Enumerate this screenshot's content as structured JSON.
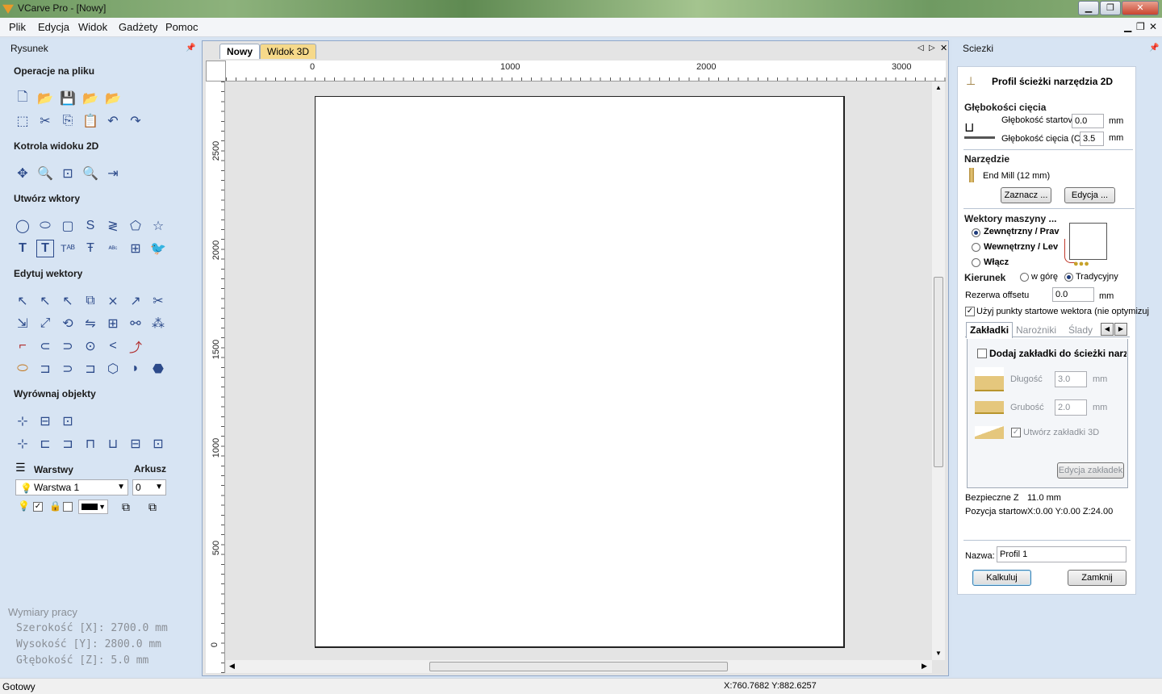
{
  "window": {
    "title": "VCarve Pro - [Nowy]"
  },
  "menu": [
    "Plik",
    "Edycja",
    "Widok",
    "Gadżety",
    "Pomoc"
  ],
  "left_panel": {
    "title": "Rysunek",
    "sections": [
      "Operacje na pliku",
      "Kotrola widoku 2D",
      "Utwórz wktory",
      "Edytuj wektory",
      "Wyrównaj objekty"
    ],
    "layers_label": "Warstwy",
    "sheet_label": "Arkusz",
    "layer_select": "Warstwa 1",
    "sheet_select": "0",
    "dimensions": {
      "title": "Wymiary pracy",
      "width": "Szerokość [X]: 2700.0 mm",
      "height": "Wysokość  [Y]: 2800.0 mm",
      "depth": "Głębokość [Z]: 5.0 mm"
    }
  },
  "tabs": [
    "Nowy",
    "Widok 3D"
  ],
  "ruler_top": [
    "0",
    "1000",
    "2000",
    "3000"
  ],
  "ruler_left": [
    "2500",
    "2000",
    "1500",
    "1000",
    "500",
    "0"
  ],
  "right_panel": {
    "title": "Sciezki",
    "heading": "Profil ścieżki narzędzia 2D",
    "cut_depths": {
      "label": "Głębokości cięcia",
      "start_label": "Głębokość startov",
      "start_value": "0.0",
      "cut_label": "Głębokość cięcia (C)",
      "cut_value": "3.5",
      "unit": "mm"
    },
    "tool": {
      "label": "Narzędzie",
      "name": "End Mill (12 mm)",
      "select_btn": "Zaznacz ...",
      "edit_btn": "Edycja ..."
    },
    "machine_vectors": {
      "label": "Wektory maszyny ...",
      "outside": "Zewnętrzny / Prav",
      "inside": "Wewnętrzny / Lev",
      "on": "Włącz"
    },
    "direction": {
      "label": "Kierunek",
      "climb": "w górę",
      "conventional": "Tradycyjny"
    },
    "offset": {
      "label": "Rezerwa offsetu",
      "value": "0.0",
      "unit": "mm"
    },
    "use_start_points": "Użyj punkty startowe wektora (nie optymizuj",
    "subtabs": [
      "Zakładki",
      "Narożniki",
      "Ślady"
    ],
    "tabs_panel": {
      "add": "Dodaj zakładki do ścieżki narz",
      "length_label": "Długość",
      "length_value": "3.0",
      "thick_label": "Grubość",
      "thick_value": "2.0",
      "unit": "mm",
      "create3d": "Utwórz zakładki 3D",
      "edit_btn": "Edycja zakładek"
    },
    "safe_z": {
      "label": "Bezpieczne Z",
      "value": "11.0 mm"
    },
    "home": {
      "label": "Pozycja startow",
      "value": "X:0.00 Y:0.00 Z:24.00"
    },
    "name": {
      "label": "Nazwa:",
      "value": "Profil 1"
    },
    "calc_btn": "Kalkuluj",
    "close_btn": "Zamknij"
  },
  "status": {
    "left": "Gotowy",
    "coords": "X:760.7682 Y:882.6257"
  }
}
